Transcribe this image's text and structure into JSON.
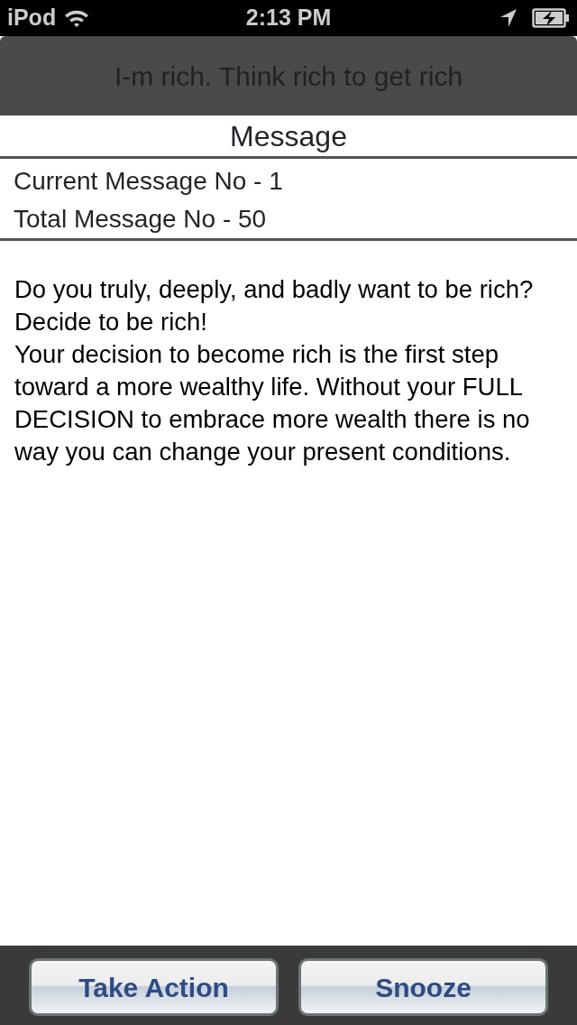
{
  "status_bar": {
    "carrier": "iPod",
    "time": "2:13 PM"
  },
  "nav_bar": {
    "title": "I-m rich. Think rich to get rich"
  },
  "header": {
    "title": "Message"
  },
  "info": [
    "Current Message No - 1",
    "Total Message No - 50"
  ],
  "body": [
    "Do you truly, deeply, and badly want to be rich?",
    "Decide to be rich!",
    "Your decision to become rich is the first step toward a more wealthy life. Without your FULL DECISION to embrace more wealth there is no way you can change your present conditions."
  ],
  "buttons": [
    "Take Action",
    "Snooze"
  ]
}
